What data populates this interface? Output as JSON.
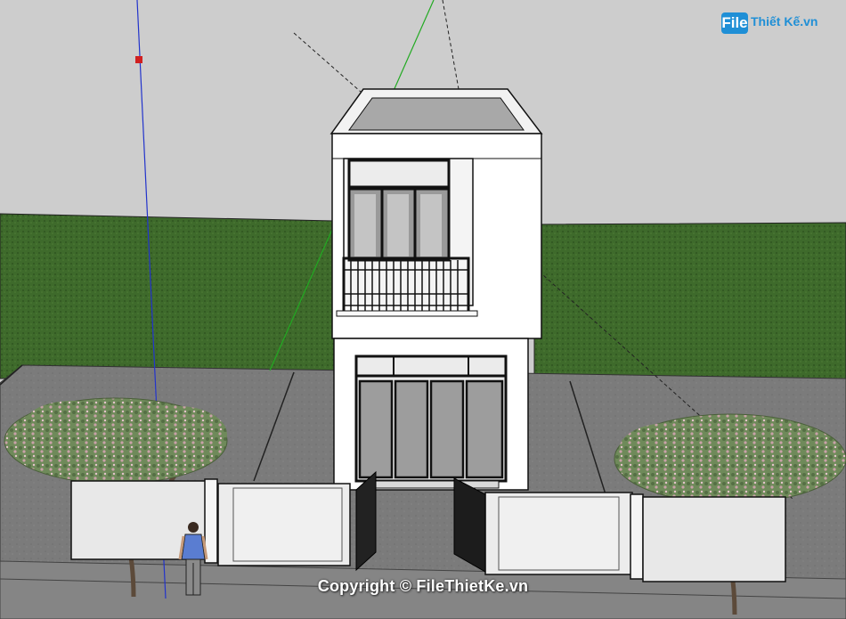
{
  "logo": {
    "badge": "File",
    "text": "Thiết Kế.vn"
  },
  "watermark": {
    "text": "Copyright © FileThietKe.vn"
  },
  "colors": {
    "sky": "#cdcdcd",
    "grass": "#3f6a2a",
    "pavement": "#7a7a7a",
    "wall": "#ffffff",
    "axis_blue": "#2233cc",
    "axis_green": "#22aa22",
    "brand_blue": "#1f8fd6"
  }
}
